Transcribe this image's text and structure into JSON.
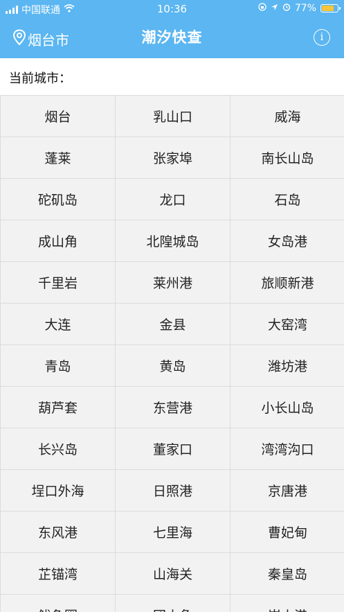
{
  "status_bar": {
    "carrier": "中国联通",
    "time": "10:36",
    "battery_percent": "77%",
    "battery_level": 0.77
  },
  "header": {
    "location": "烟台市",
    "title": "潮汐快查",
    "info_glyph": "i"
  },
  "current_city_label": "当前城市：",
  "cities": [
    "烟台",
    "乳山口",
    "威海",
    "蓬莱",
    "张家埠",
    "南长山岛",
    "砣矶岛",
    "龙口",
    "石岛",
    "成山角",
    "北隍城岛",
    "女岛港",
    "千里岩",
    "莱州港",
    "旅顺新港",
    "大连",
    "金县",
    "大窑湾",
    "青岛",
    "黄岛",
    "潍坊港",
    "葫芦套",
    "东营港",
    "小长山岛",
    "长兴岛",
    "董家口",
    "湾湾沟口",
    "埕口外海",
    "日照港",
    "京唐港",
    "东风港",
    "七里海",
    "曹妃甸",
    "芷锚湾",
    "山海关",
    "秦皇岛",
    "鲅鱼圈",
    "团山角",
    "岚山港"
  ],
  "colors": {
    "header_bg": "#5bb6f1",
    "cell_bg": "#f2f2f2",
    "grid_line": "#dcdcdc",
    "battery_fill": "#f5c53a"
  },
  "icons": [
    "signal-icon",
    "wifi-icon",
    "rotation-lock-icon",
    "location-arrow-icon",
    "alarm-icon",
    "battery-icon",
    "map-pin-icon",
    "info-icon"
  ]
}
